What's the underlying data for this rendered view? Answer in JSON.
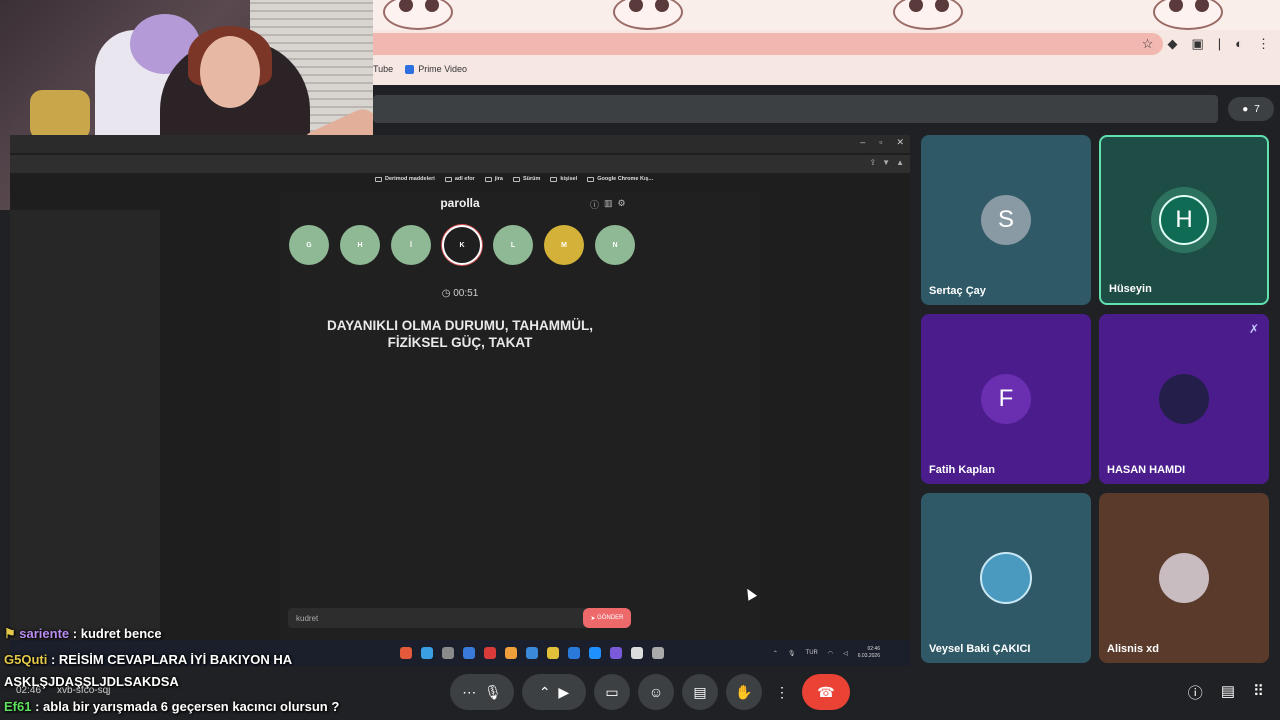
{
  "browser": {
    "bookmarks": [
      {
        "label": "Tube"
      },
      {
        "label": "Prime Video"
      }
    ],
    "people_count": "7"
  },
  "shared_screen": {
    "inner_bookmarks": [
      "Derimod maddeleri",
      "adl efor",
      "jira",
      "Sürüm",
      "kişisel",
      "Google Chrome Kış..."
    ],
    "game": {
      "title": "parolla",
      "letters": [
        {
          "char": "G",
          "state": "correct"
        },
        {
          "char": "H",
          "state": "correct"
        },
        {
          "char": "İ",
          "state": "correct"
        },
        {
          "char": "K",
          "state": "active"
        },
        {
          "char": "L",
          "state": "correct"
        },
        {
          "char": "M",
          "state": "pass"
        },
        {
          "char": "N",
          "state": "correct"
        }
      ],
      "timer": "00:51",
      "clue": "DAYANIKLI OLMA DURUMU, TAHAMMÜL, FİZİKSEL GÜÇ, TAKAT",
      "answer_value": "kudret",
      "send_label": "GÖNDER"
    },
    "taskbar": {
      "lang": "TUR",
      "time": "02:46",
      "date": "6.03.2026"
    }
  },
  "participants": [
    {
      "name": "Sertaç Çay",
      "initial": "S",
      "avatar_color": "#8a9aa4",
      "bg": "#2f5966",
      "active": false,
      "muted": false
    },
    {
      "name": "Hüseyin",
      "initial": "H",
      "avatar_color": "#0f6b54",
      "bg": "#1d4d44",
      "active": true,
      "muted": false
    },
    {
      "name": "Fatih Kaplan",
      "initial": "F",
      "avatar_color": "#6a2fb0",
      "bg": "#4a1c8c",
      "active": false,
      "muted": false
    },
    {
      "name": "HASAN HAMDI",
      "initial": "",
      "avatar_color": "#231f4a",
      "bg": "#4a1c8c",
      "active": false,
      "muted": true
    },
    {
      "name": "Veysel Baki ÇAKICI",
      "initial": "",
      "avatar_color": "#4a9ac0",
      "bg": "#2f5966",
      "active": false,
      "muted": false
    },
    {
      "name": "Alisnis xd",
      "initial": "",
      "avatar_color": "#c8bcc0",
      "bg": "#5a3a2a",
      "active": false,
      "muted": false
    }
  ],
  "chat": [
    {
      "user": "sariente",
      "user_color": "#b98cf2",
      "text": " : kudret bence"
    },
    {
      "user": "G5Quti",
      "user_color": "#e3c84a",
      "text": " : REİSİM CEVAPLARA İYİ BAKIYON HA"
    },
    {
      "user": "",
      "user_color": "#ffffff",
      "text": "ASKLŞJDAŞŞLJDLSAKDSA"
    },
    {
      "user": "Ef61",
      "user_color": "#5ee05e",
      "text": " : abla bir yarışmada 6 geçersen kacıncı olursun ?"
    }
  ],
  "meet_footer": {
    "time": "02:46",
    "code": "xvb-sfco-sqj"
  },
  "colors": {
    "end_call": "#ea4335",
    "active_border": "#61e0b0"
  }
}
